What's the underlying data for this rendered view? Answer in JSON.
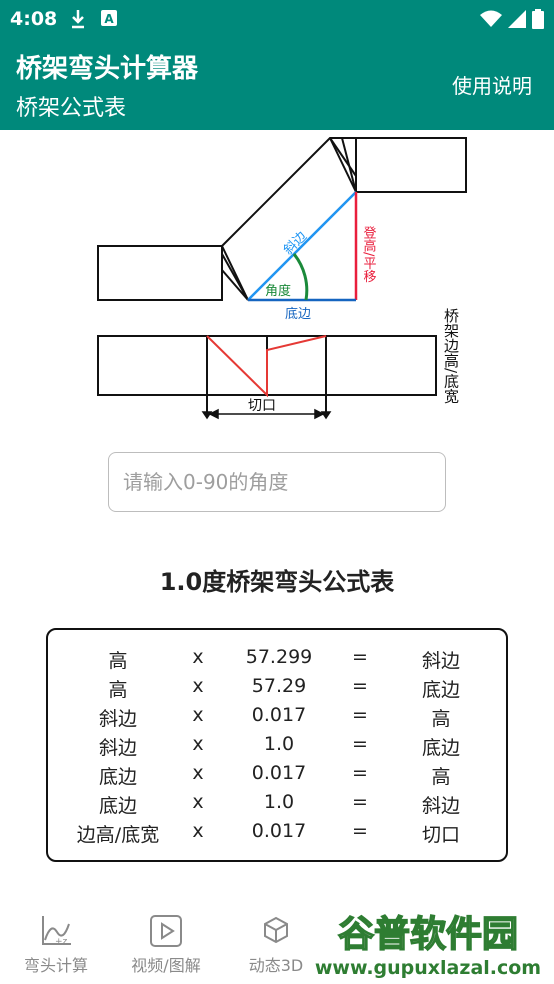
{
  "status_bar": {
    "time": "4:08",
    "icons": [
      "download-icon",
      "a-notification-icon",
      "wifi-icon",
      "signal-icon",
      "battery-icon"
    ]
  },
  "app_bar": {
    "title": "桥架弯头计算器",
    "subtitle": "桥架公式表",
    "help_label": "使用说明"
  },
  "diagram": {
    "labels": {
      "hypotenuse": "斜边",
      "rise": "登高/平移",
      "angle": "角度",
      "base": "底边",
      "side_height": "桥架边高/底宽",
      "cut": "切口"
    },
    "colors": {
      "hypotenuse": "#2196f3",
      "rise": "#e91e3c",
      "angle": "#1b8a3a",
      "base": "#1565c0",
      "cut_lines": "#e53935"
    }
  },
  "angle_input": {
    "placeholder": "请输入0-90的角度",
    "value": ""
  },
  "table": {
    "title": "1.0度桥架弯头公式表",
    "rows": [
      [
        "高",
        "x",
        "57.299",
        "=",
        "斜边"
      ],
      [
        "高",
        "x",
        "57.29",
        "=",
        "底边"
      ],
      [
        "斜边",
        "x",
        "0.017",
        "=",
        "高"
      ],
      [
        "斜边",
        "x",
        "1.0",
        "=",
        "底边"
      ],
      [
        "底边",
        "x",
        "0.017",
        "=",
        "高"
      ],
      [
        "底边",
        "x",
        "1.0",
        "=",
        "斜边"
      ],
      [
        "边高/底宽",
        "x",
        "0.017",
        "=",
        "切口"
      ]
    ]
  },
  "bottom_nav": {
    "items": [
      {
        "label": "弯头计算",
        "icon": "chart-icon"
      },
      {
        "label": "视频/图解",
        "icon": "play-video-icon"
      },
      {
        "label": "动态3D",
        "icon": "3d-cube-icon"
      }
    ]
  },
  "watermark": {
    "text": "谷普软件园",
    "url": "www.gupuxlazal.com"
  },
  "theme": {
    "primary": "#00897b"
  }
}
